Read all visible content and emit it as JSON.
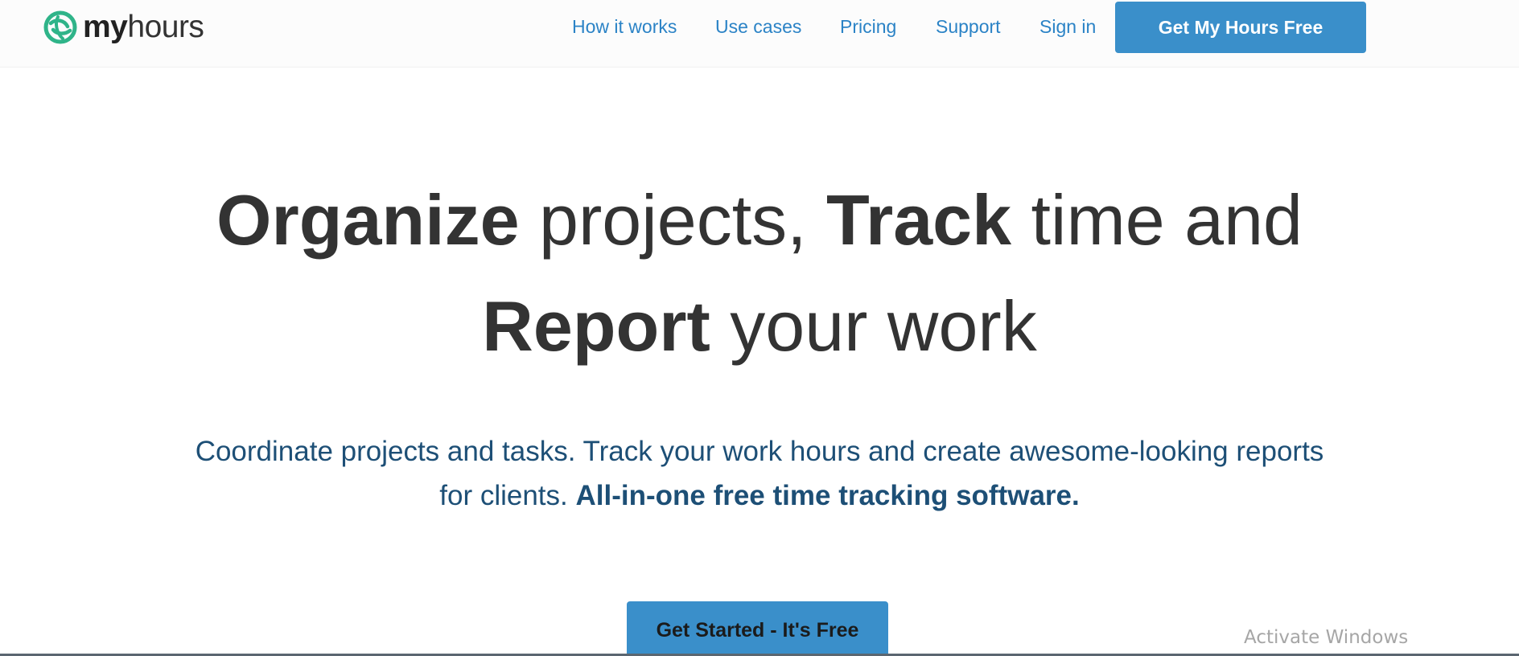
{
  "brand": {
    "name_bold": "my",
    "name_light": "hours",
    "accent_color": "#2fb489"
  },
  "nav": {
    "links": [
      {
        "label": "How it works",
        "icon": ""
      },
      {
        "label": "Use cases"
      },
      {
        "label": "Pricing"
      },
      {
        "label": "Support"
      },
      {
        "label": "Sign in"
      }
    ],
    "cta_label": "Get My Hours Free",
    "link_color": "#2b83c6",
    "cta_color": "#3a8fca"
  },
  "hero": {
    "line1": [
      {
        "text": "Organize",
        "bold": true
      },
      {
        "text": " projects, ",
        "bold": false
      },
      {
        "text": "Track",
        "bold": true
      },
      {
        "text": " time and",
        "bold": false
      }
    ],
    "line2": [
      {
        "text": "Report",
        "bold": true
      },
      {
        "text": " your work",
        "bold": false
      }
    ]
  },
  "subheading": {
    "line1": "Coordinate projects and tasks. Track your work hours and create awesome-looking reports",
    "line2_regular": "for clients. ",
    "line2_bold": "All-in-one free time tracking software."
  },
  "main_cta": {
    "label": "Get Started - It's Free"
  },
  "overlay": {
    "watermark": "Activate Windows"
  }
}
